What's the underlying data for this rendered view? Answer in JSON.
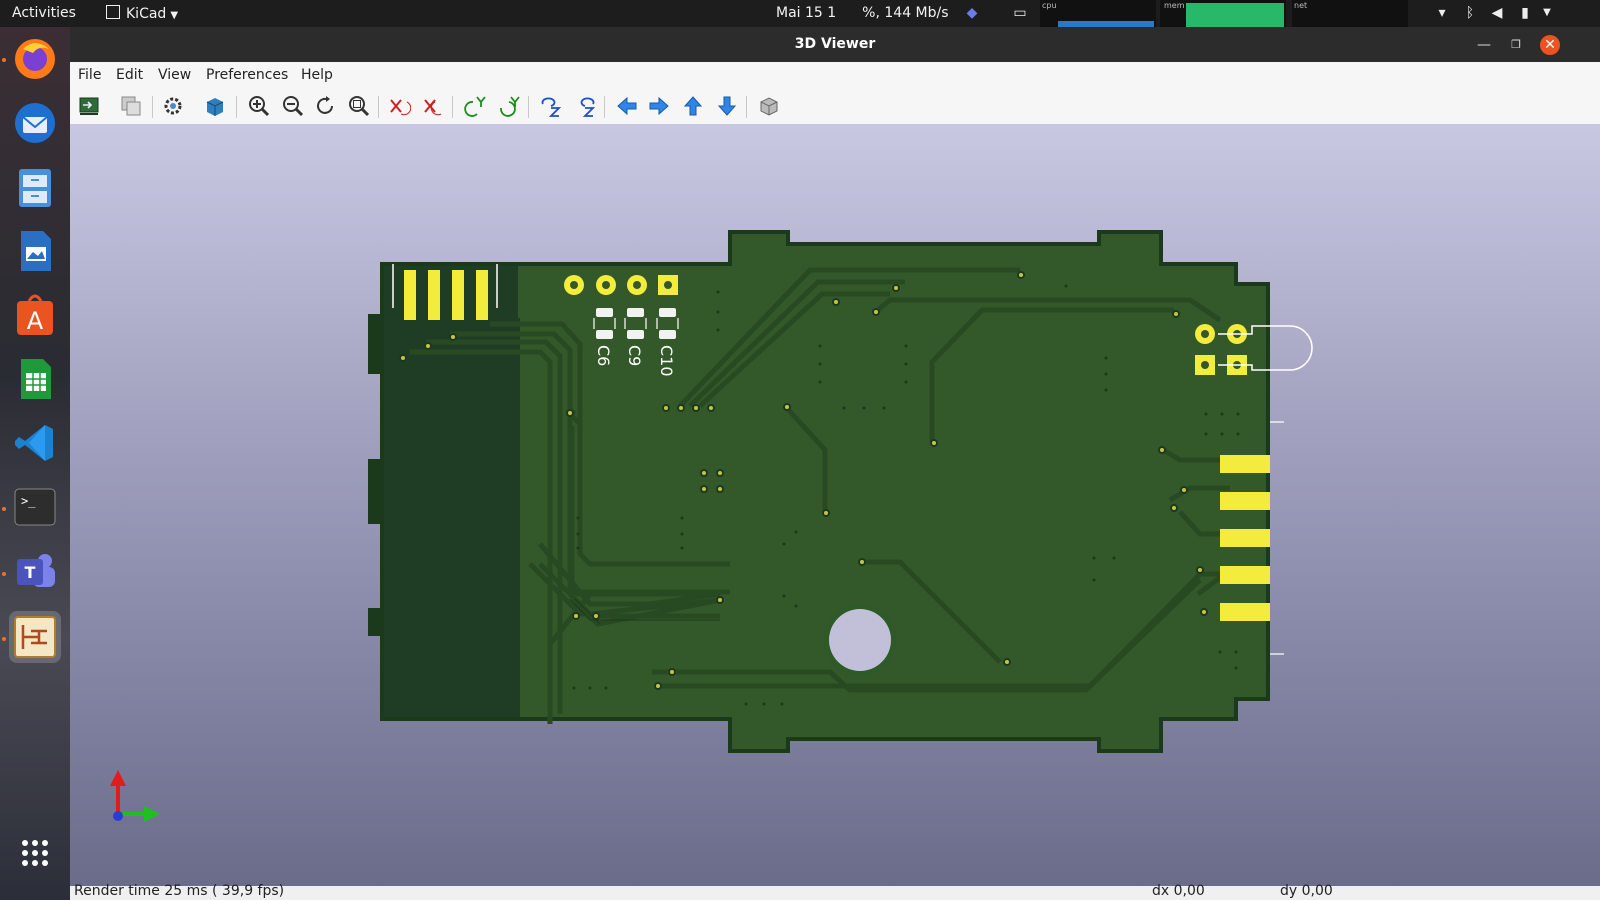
{
  "topbar": {
    "activities": "Activities",
    "app_menu": "KiCad",
    "clock": "Mai 15  1",
    "net_speed": "%, 144 Mb/s",
    "cpu_label": "cpu",
    "mem_label": "mem",
    "net_label": "net"
  },
  "dock": {
    "items": [
      "firefox-icon",
      "thunderbird-icon",
      "files-icon",
      "writer-icon",
      "app-center-icon",
      "calc-icon",
      "vscode-icon",
      "terminal-icon",
      "teams-icon",
      "kicad-pcb-icon"
    ],
    "show_apps": "show-apps-icon"
  },
  "window": {
    "title": "3D Viewer"
  },
  "menubar": {
    "file": "File",
    "edit": "Edit",
    "view": "View",
    "preferences": "Preferences",
    "help": "Help"
  },
  "toolbar": {
    "items": [
      "reload-board-icon",
      "copy-3d-image-icon",
      "render-options-icon",
      "raytracing-icon",
      "zoom-in-icon",
      "zoom-out-icon",
      "redraw-icon",
      "zoom-fit-icon",
      "rotate-x-cw-icon",
      "rotate-x-ccw-icon",
      "rotate-y-cw-icon",
      "rotate-y-ccw-icon",
      "rotate-z-cw-icon",
      "rotate-z-ccw-icon",
      "move-left-icon",
      "move-right-icon",
      "move-up-icon",
      "move-down-icon",
      "orthographic-icon"
    ]
  },
  "board": {
    "ref_labels": [
      "C6",
      "C9",
      "C10"
    ],
    "colors": {
      "mask": "#33582a",
      "copper": "#2a4a22",
      "pad": "#f4ec3c",
      "silk": "#ffffff",
      "outline": "#1b3a1c",
      "board_dark": "#1f3d24"
    }
  },
  "statusbar": {
    "render_time": "Render time 25 ms ( 39,9 fps)",
    "dx": "dx 0,00",
    "dy": "dy 0,00"
  }
}
